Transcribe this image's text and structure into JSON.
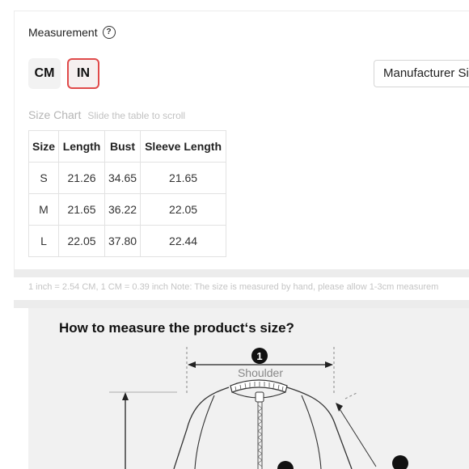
{
  "measurement": {
    "title": "Measurement",
    "help_icon": "question-circle-icon",
    "units": [
      {
        "label": "CM",
        "selected": false
      },
      {
        "label": "IN",
        "selected": true
      }
    ],
    "size_select": {
      "value": "Manufacturer Si"
    },
    "accent_color": "#e04a4a"
  },
  "size_chart": {
    "title": "Size Chart",
    "hint": "Slide the table to scroll",
    "headers": [
      "Size",
      "Length",
      "Bust",
      "Sleeve Length"
    ],
    "rows": [
      [
        "S",
        "21.26",
        "34.65",
        "21.65"
      ],
      [
        "M",
        "21.65",
        "36.22",
        "22.05"
      ],
      [
        "L",
        "22.05",
        "37.80",
        "22.44"
      ]
    ]
  },
  "note": "1 inch = 2.54 CM, 1 CM = 0.39 inch Note: The size is measured by hand, please allow 1-3cm measurem",
  "guide": {
    "title": "How to measure the product‘s size?",
    "marker_1": "1",
    "shoulder_label": "Shoulder"
  }
}
